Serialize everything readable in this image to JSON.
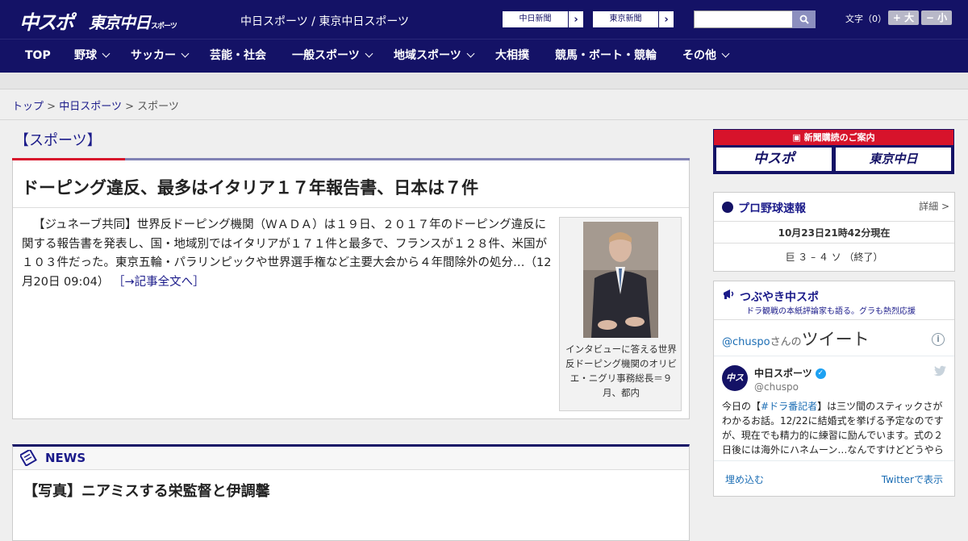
{
  "header": {
    "logo_chuspo": "中スポ",
    "logo_tokyo": "東京中日",
    "logo_tokyo_small": "スポーツ",
    "site_name": "中日スポーツ / 東京中日スポーツ",
    "paper_buttons": [
      "中日新聞",
      "東京新聞"
    ],
    "search_placeholder": "",
    "font_size_label": "文字（0）",
    "font_plus": "+ 大",
    "font_minus": "− 小"
  },
  "nav": {
    "items": [
      {
        "label": "TOP",
        "dropdown": false
      },
      {
        "label": "野球",
        "dropdown": true
      },
      {
        "label": "サッカー",
        "dropdown": true
      },
      {
        "label": "芸能・社会",
        "dropdown": false
      },
      {
        "label": "一般スポーツ",
        "dropdown": true
      },
      {
        "label": "地域スポーツ",
        "dropdown": true
      },
      {
        "label": "大相撲",
        "dropdown": false
      },
      {
        "label": "競馬・ボート・競輪",
        "dropdown": false
      },
      {
        "label": "その他",
        "dropdown": true
      }
    ]
  },
  "breadcrumb": {
    "items": [
      "トップ",
      "中日スポーツ",
      "スポーツ"
    ],
    "separator": ">"
  },
  "main": {
    "section_title": "【スポーツ】",
    "article": {
      "headline": "ドーピング違反、最多はイタリア１７年報告書、日本は７件",
      "lead": "【ジュネーブ共同】世界反ドーピング機関（ＷＡＤＡ）は１９日、２０１７年のドーピング違反に関する報告書を発表し、国・地域別ではイタリアが１７１件と最多で、フランスが１２８件、米国が１０３件だった。東京五輪・パラリンピックや世界選手権など主要大会から４年間除外の処分…（12月20日 09:04）",
      "more_link": "［→記事全文へ］",
      "photo_caption": "インタビューに答える世界反ドーピング機関のオリビエ・ニグリ事務総長＝９月、都内"
    },
    "news": {
      "label": "NEWS",
      "headline": "【写真】ニアミスする栄監督と伊調馨"
    }
  },
  "sidebar": {
    "subscribe": {
      "title": "新聞購読のご案内",
      "logo_left": "中スポ",
      "logo_right": "東京中日"
    },
    "baseball": {
      "title": "プロ野球速報",
      "detail": "詳細 >",
      "timestamp": "10月23日21時42分現在",
      "score": "巨 ３ – ４ ソ （終了）"
    },
    "twitter": {
      "title": "つぶやき中スポ",
      "subtitle": "ドラ観戦の本紙評論家も語る。グラも熱烈応援",
      "handle": "@chuspo",
      "handle_suffix": "さんの",
      "tweets_label": "ツイート",
      "account_name": "中日スポーツ",
      "account_user": "@chuspo",
      "avatar_text": "中スポ",
      "tweet_prefix": "今日の【",
      "tweet_tag": "#ドラ番記者",
      "tweet_body": "】は三ツ間のスティックさがわかるお話。12/22に結婚式を挙げる予定なのですが、現在でも精力的に練習に励んでいます。式の２日後には海外にハネムーン…なんですけどどうやら",
      "embed": "埋め込む",
      "view": "Twitterで表示"
    }
  },
  "colors": {
    "navy": "#141266",
    "red": "#d7132b",
    "link": "#1b1b8a",
    "twitter_blue": "#1da1f2"
  }
}
